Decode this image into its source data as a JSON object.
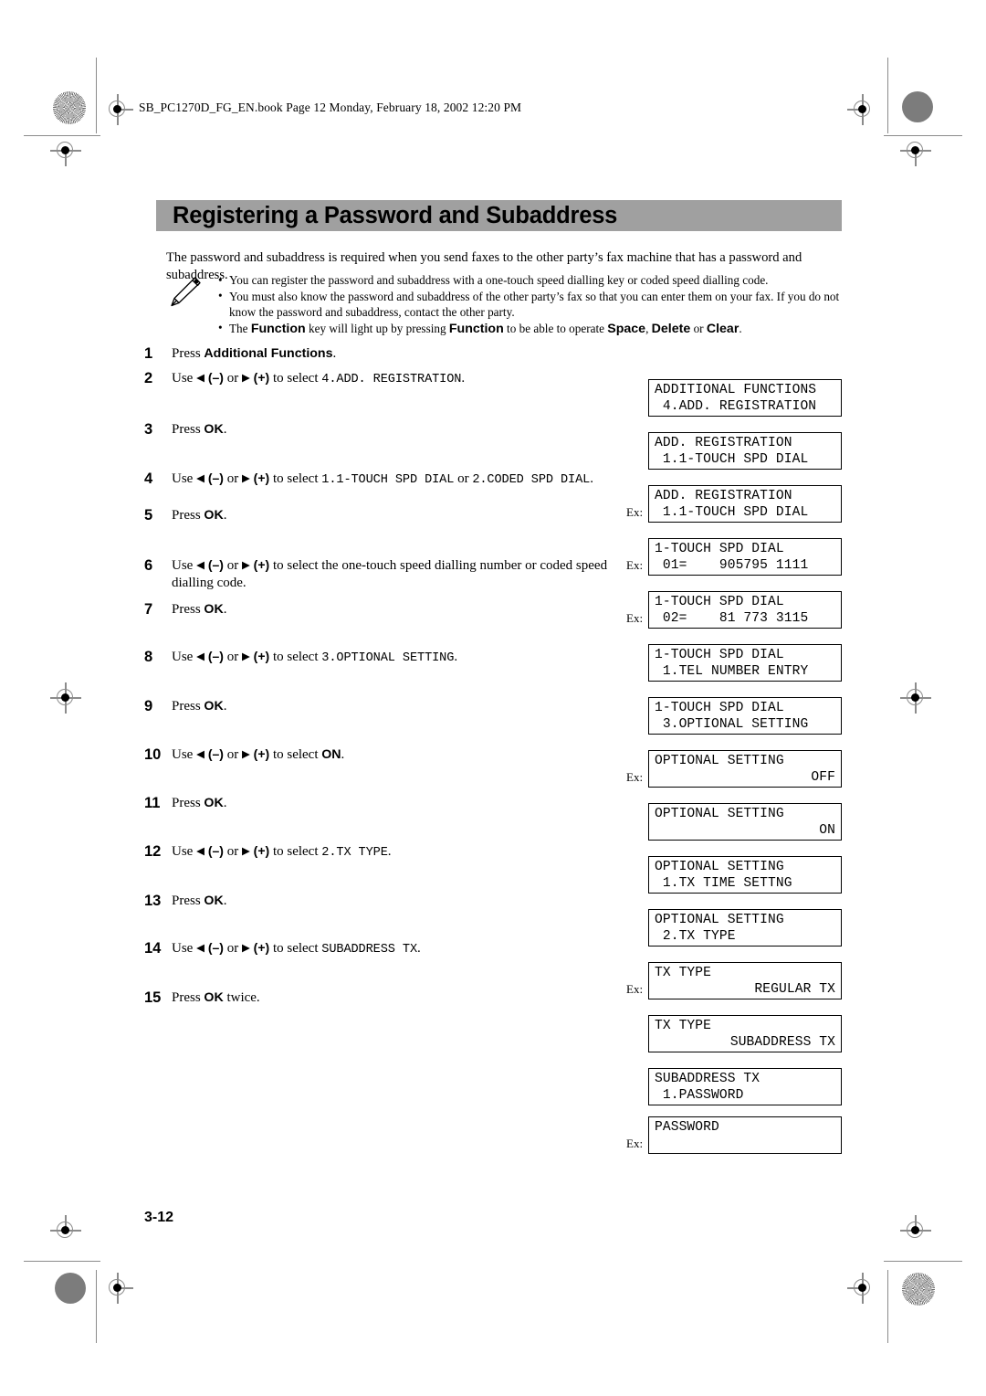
{
  "running_header": "SB_PC1270D_FG_EN.book  Page 12  Monday, February 18, 2002  12:20 PM",
  "title": "Registering a Password and Subaddress",
  "intro": "The password and subaddress is required when you send faxes to the other party’s fax machine that has a password and subaddress.",
  "note": {
    "icon": "pencil-note-icon",
    "bullets": [
      {
        "parts": [
          {
            "t": "You can register the password and subaddress with a one-touch speed dialling key or coded speed dialling code.",
            "s": "n"
          }
        ]
      },
      {
        "parts": [
          {
            "t": "You must also know the password and subaddress of the other party’s fax so that you can enter them on your fax. If you do not know the password and subaddress, contact the other party.",
            "s": "n"
          }
        ]
      },
      {
        "parts": [
          {
            "t": "The ",
            "s": "n"
          },
          {
            "t": "Function",
            "s": "b"
          },
          {
            "t": " key will light up by pressing ",
            "s": "n"
          },
          {
            "t": "Function",
            "s": "b"
          },
          {
            "t": " to be able to operate ",
            "s": "n"
          },
          {
            "t": "Space",
            "s": "b"
          },
          {
            "t": ", ",
            "s": "n"
          },
          {
            "t": "Delete",
            "s": "b"
          },
          {
            "t": " or ",
            "s": "n"
          },
          {
            "t": "Clear",
            "s": "b"
          },
          {
            "t": ".",
            "s": "n"
          }
        ]
      }
    ]
  },
  "steps": [
    {
      "num": "1",
      "gap": 0,
      "parts": [
        {
          "t": "Press ",
          "s": "n"
        },
        {
          "t": "Additional Functions",
          "s": "b"
        },
        {
          "t": ".",
          "s": "n"
        }
      ]
    },
    {
      "num": "2",
      "gap": 8,
      "parts": [
        {
          "t": "Use ",
          "s": "n"
        },
        {
          "t": "◀",
          "s": "a"
        },
        {
          "t": " (–)",
          "s": "p"
        },
        {
          "t": " or ",
          "s": "n"
        },
        {
          "t": "▶",
          "s": "a"
        },
        {
          "t": " (+)",
          "s": "p"
        },
        {
          "t": " to select ",
          "s": "n"
        },
        {
          "t": "4.ADD. REGISTRATION",
          "s": "m"
        },
        {
          "t": ".",
          "s": "n"
        }
      ]
    },
    {
      "num": "3",
      "gap": 36,
      "parts": [
        {
          "t": "Press ",
          "s": "n"
        },
        {
          "t": "OK",
          "s": "b"
        },
        {
          "t": ".",
          "s": "n"
        }
      ]
    },
    {
      "num": "4",
      "gap": 36,
      "parts": [
        {
          "t": "Use ",
          "s": "n"
        },
        {
          "t": "◀",
          "s": "a"
        },
        {
          "t": " (–)",
          "s": "p"
        },
        {
          "t": " or ",
          "s": "n"
        },
        {
          "t": "▶",
          "s": "a"
        },
        {
          "t": " (+)",
          "s": "p"
        },
        {
          "t": " to select ",
          "s": "n"
        },
        {
          "t": "1.1-TOUCH SPD DIAL",
          "s": "m"
        },
        {
          "t": " or ",
          "s": "n"
        },
        {
          "t": "2.CODED SPD DIAL",
          "s": "m"
        },
        {
          "t": ".",
          "s": "n"
        }
      ]
    },
    {
      "num": "5",
      "gap": 20,
      "parts": [
        {
          "t": "Press ",
          "s": "n"
        },
        {
          "t": "OK",
          "s": "b"
        },
        {
          "t": ".",
          "s": "n"
        }
      ]
    },
    {
      "num": "6",
      "gap": 36,
      "parts": [
        {
          "t": "Use ",
          "s": "n"
        },
        {
          "t": "◀",
          "s": "a"
        },
        {
          "t": " (–)",
          "s": "p"
        },
        {
          "t": " or ",
          "s": "n"
        },
        {
          "t": "▶",
          "s": "a"
        },
        {
          "t": " (+)",
          "s": "p"
        },
        {
          "t": " to select the one-touch speed dialling number or coded speed dialling code.",
          "s": "n"
        }
      ]
    },
    {
      "num": "7",
      "gap": 10,
      "parts": [
        {
          "t": "Press ",
          "s": "n"
        },
        {
          "t": "OK",
          "s": "b"
        },
        {
          "t": ".",
          "s": "n"
        }
      ]
    },
    {
      "num": "8",
      "gap": 34,
      "parts": [
        {
          "t": "Use ",
          "s": "n"
        },
        {
          "t": "◀",
          "s": "a"
        },
        {
          "t": " (–)",
          "s": "p"
        },
        {
          "t": " or ",
          "s": "n"
        },
        {
          "t": "▶",
          "s": "a"
        },
        {
          "t": " (+)",
          "s": "p"
        },
        {
          "t": " to select ",
          "s": "n"
        },
        {
          "t": "3.OPTIONAL SETTING",
          "s": "m"
        },
        {
          "t": ".",
          "s": "n"
        }
      ]
    },
    {
      "num": "9",
      "gap": 34,
      "parts": [
        {
          "t": "Press ",
          "s": "n"
        },
        {
          "t": "OK",
          "s": "b"
        },
        {
          "t": ".",
          "s": "n"
        }
      ]
    },
    {
      "num": "10",
      "gap": 34,
      "parts": [
        {
          "t": "Use ",
          "s": "n"
        },
        {
          "t": "◀",
          "s": "a"
        },
        {
          "t": " (–)",
          "s": "p"
        },
        {
          "t": " or ",
          "s": "n"
        },
        {
          "t": "▶",
          "s": "a"
        },
        {
          "t": " (+)",
          "s": "p"
        },
        {
          "t": " to select ",
          "s": "n"
        },
        {
          "t": "ON",
          "s": "b"
        },
        {
          "t": ".",
          "s": "n"
        }
      ]
    },
    {
      "num": "11",
      "gap": 34,
      "parts": [
        {
          "t": "Press ",
          "s": "n"
        },
        {
          "t": "OK",
          "s": "b"
        },
        {
          "t": ".",
          "s": "n"
        }
      ]
    },
    {
      "num": "12",
      "gap": 34,
      "parts": [
        {
          "t": "Use ",
          "s": "n"
        },
        {
          "t": "◀",
          "s": "a"
        },
        {
          "t": " (–)",
          "s": "p"
        },
        {
          "t": " or ",
          "s": "n"
        },
        {
          "t": "▶",
          "s": "a"
        },
        {
          "t": " (+)",
          "s": "p"
        },
        {
          "t": " to select ",
          "s": "n"
        },
        {
          "t": "2.TX TYPE",
          "s": "m"
        },
        {
          "t": ".",
          "s": "n"
        }
      ]
    },
    {
      "num": "13",
      "gap": 34,
      "parts": [
        {
          "t": "Press ",
          "s": "n"
        },
        {
          "t": "OK",
          "s": "b"
        },
        {
          "t": ".",
          "s": "n"
        }
      ]
    },
    {
      "num": "14",
      "gap": 34,
      "parts": [
        {
          "t": "Use ",
          "s": "n"
        },
        {
          "t": "◀",
          "s": "a"
        },
        {
          "t": " (–)",
          "s": "p"
        },
        {
          "t": " or ",
          "s": "n"
        },
        {
          "t": "▶",
          "s": "a"
        },
        {
          "t": " (+)",
          "s": "p"
        },
        {
          "t": " to select ",
          "s": "n"
        },
        {
          "t": "SUBADDRESS TX",
          "s": "m"
        },
        {
          "t": ".",
          "s": "n"
        }
      ]
    },
    {
      "num": "15",
      "gap": 34,
      "parts": [
        {
          "t": "Press ",
          "s": "n"
        },
        {
          "t": "OK",
          "s": "b"
        },
        {
          "t": " twice.",
          "s": "n"
        }
      ]
    }
  ],
  "lcd_panels": [
    {
      "ex": "",
      "line1": "ADDITIONAL FUNCTIONS",
      "line2": " 4.ADD. REGISTRATION",
      "align2": "left",
      "gap": 0
    },
    {
      "ex": "",
      "line1": "ADD. REGISTRATION",
      "line2": " 1.1-TOUCH SPD DIAL",
      "align2": "left",
      "gap": 13
    },
    {
      "ex": "Ex:",
      "line1": "ADD. REGISTRATION",
      "line2": " 1.1-TOUCH SPD DIAL",
      "align2": "left",
      "gap": 13
    },
    {
      "ex": "Ex:",
      "line1": "1-TOUCH SPD DIAL",
      "line2": " 01=    905795 1111",
      "align2": "left",
      "gap": 13
    },
    {
      "ex": "Ex:",
      "line1": "1-TOUCH SPD DIAL",
      "line2": " 02=    81 773 3115",
      "align2": "left",
      "gap": 13
    },
    {
      "ex": "",
      "line1": "1-TOUCH SPD DIAL",
      "line2": " 1.TEL NUMBER ENTRY",
      "align2": "left",
      "gap": 13
    },
    {
      "ex": "",
      "line1": "1-TOUCH SPD DIAL",
      "line2": " 3.OPTIONAL SETTING",
      "align2": "left",
      "gap": 13
    },
    {
      "ex": "Ex:",
      "line1": "OPTIONAL SETTING",
      "line2": "OFF",
      "align2": "right",
      "gap": 13
    },
    {
      "ex": "",
      "line1": "OPTIONAL SETTING",
      "line2": "ON",
      "align2": "right",
      "gap": 13
    },
    {
      "ex": "",
      "line1": "OPTIONAL SETTING",
      "line2": " 1.TX TIME SETTNG",
      "align2": "left",
      "gap": 13
    },
    {
      "ex": "",
      "line1": "OPTIONAL SETTING",
      "line2": " 2.TX TYPE",
      "align2": "left",
      "gap": 13
    },
    {
      "ex": "Ex:",
      "line1": "TX TYPE",
      "line2": "REGULAR TX",
      "align2": "right",
      "gap": 13
    },
    {
      "ex": "",
      "line1": "TX TYPE",
      "line2": "SUBADDRESS TX",
      "align2": "right",
      "gap": 13
    },
    {
      "ex": "",
      "line1": "SUBADDRESS TX",
      "line2": " 1.PASSWORD",
      "align2": "left",
      "gap": 13
    },
    {
      "ex": "Ex:",
      "line1": "PASSWORD",
      "line2": "",
      "align2": "left",
      "gap": 8
    }
  ],
  "folio": "3-12"
}
